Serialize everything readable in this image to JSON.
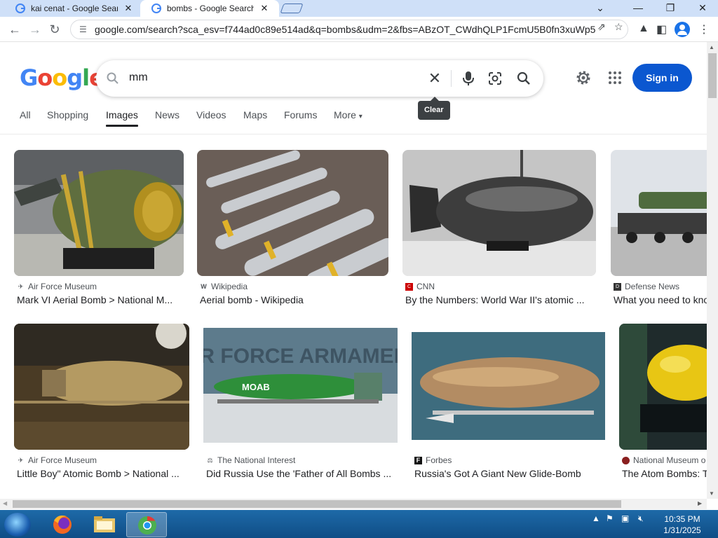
{
  "browser": {
    "tabs": [
      {
        "title": "kai cenat - Google Search",
        "active": false
      },
      {
        "title": "bombs - Google Search",
        "active": true
      }
    ],
    "url": "google.com/search?sca_esv=f744ad0c89e514ad&q=bombs&udm=2&fbs=ABzOT_CWdhQLP1FcmU5B0fn3xuWp5..."
  },
  "google": {
    "logo": [
      "G",
      "o",
      "o",
      "g",
      "l",
      "e"
    ],
    "search_value": "mm",
    "clear_tooltip": "Clear",
    "signin_label": "Sign in",
    "tabs": [
      "All",
      "Shopping",
      "Images",
      "News",
      "Videos",
      "Maps",
      "Forums",
      "More"
    ],
    "active_tab": "Images",
    "results": [
      {
        "source": "Air Force Museum",
        "caption": "Mark VI Aerial Bomb > National M..."
      },
      {
        "source": "Wikipedia",
        "caption": "Aerial bomb - Wikipedia"
      },
      {
        "source": "CNN",
        "caption": "By the Numbers: World War II's atomic ..."
      },
      {
        "source": "Defense News",
        "caption": "What you need to kno"
      },
      {
        "source": "Air Force Museum",
        "caption": "Little Boy\" Atomic Bomb > National ..."
      },
      {
        "source": "The National Interest",
        "caption": "Did Russia Use the 'Father of All Bombs ..."
      },
      {
        "source": "Forbes",
        "caption": "Russia's Got A Giant New Glide-Bomb"
      },
      {
        "source": "National Museum o",
        "caption": "The Atom Bombs: T"
      }
    ],
    "image_text": {
      "moab": "MOAB",
      "building_sign": "AIR FORCE ARMAMENT"
    }
  },
  "taskbar": {
    "time": "10:35 PM",
    "date": "1/31/2025"
  },
  "colors": {
    "accent": "#0b57d0",
    "tabstrip": "#cfe0f8",
    "taskbar": "#1e6aa8"
  }
}
